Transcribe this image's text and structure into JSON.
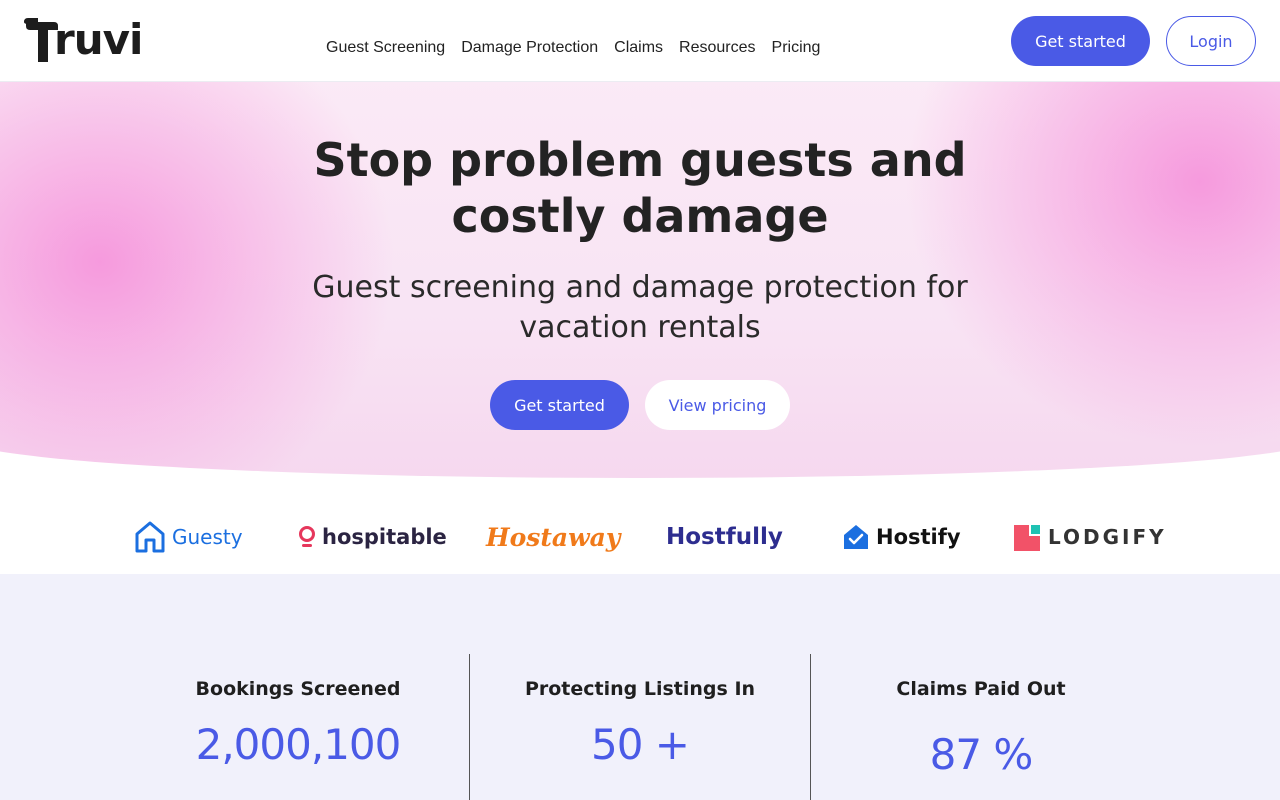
{
  "brand": {
    "name": "ruvi"
  },
  "nav": {
    "items": [
      "Guest Screening",
      "Damage Protection",
      "Claims",
      "Resources",
      "Pricing"
    ]
  },
  "header": {
    "get_started_label": "Get started",
    "login_label": "Login"
  },
  "hero": {
    "title_line1": "Stop problem guests and",
    "title_line2": "costly damage",
    "subtitle_line1": "Guest screening and damage protection for",
    "subtitle_line2": "vacation rentals",
    "primary_cta": "Get started",
    "secondary_cta": "View pricing"
  },
  "partners": [
    {
      "name": "Guesty",
      "color": "#1b6fe0"
    },
    {
      "name": "hospitable",
      "color": "#2b2442"
    },
    {
      "name": "Hostaway",
      "color": "#f07a1a"
    },
    {
      "name": "Hostfully",
      "color": "#2d2d8f"
    },
    {
      "name": "Hostify",
      "color": "#111111"
    },
    {
      "name": "LODGIFY",
      "color": "#333333"
    }
  ],
  "stats": [
    {
      "label": "Bookings Screened",
      "value": "2,000,100"
    },
    {
      "label": "Protecting Listings In",
      "value": "50 +"
    },
    {
      "label": "Claims Paid Out",
      "value": "87 %"
    }
  ],
  "colors": {
    "accent": "#4a5ae6",
    "hero_pink": "#f696dc",
    "stats_bg": "#f1f1fb"
  }
}
